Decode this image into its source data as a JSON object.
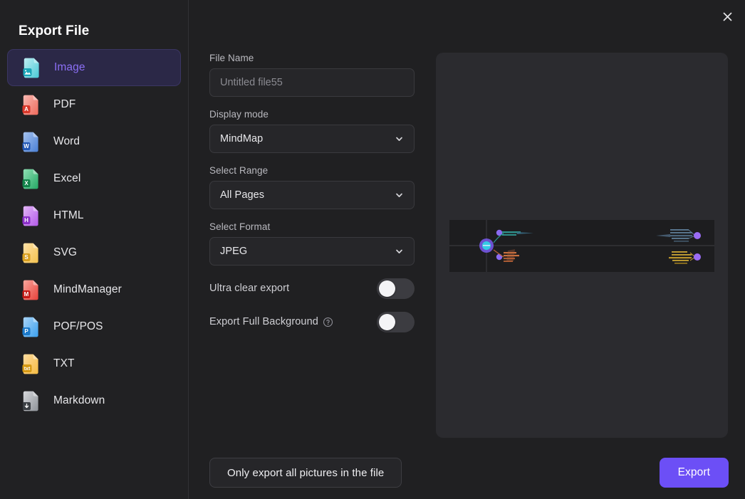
{
  "dialog": {
    "title": "Export File",
    "close_label": "×"
  },
  "sidebar": {
    "items": [
      {
        "label": "Image",
        "icon": "image-file-icon",
        "selected": true
      },
      {
        "label": "PDF",
        "icon": "pdf-file-icon",
        "selected": false
      },
      {
        "label": "Word",
        "icon": "word-file-icon",
        "selected": false
      },
      {
        "label": "Excel",
        "icon": "excel-file-icon",
        "selected": false
      },
      {
        "label": "HTML",
        "icon": "html-file-icon",
        "selected": false
      },
      {
        "label": "SVG",
        "icon": "svg-file-icon",
        "selected": false
      },
      {
        "label": "MindManager",
        "icon": "mindmanager-file-icon",
        "selected": false
      },
      {
        "label": "POF/POS",
        "icon": "pof-pos-file-icon",
        "selected": false
      },
      {
        "label": "TXT",
        "icon": "txt-file-icon",
        "selected": false
      },
      {
        "label": "Markdown",
        "icon": "markdown-file-icon",
        "selected": false
      }
    ]
  },
  "form": {
    "file_name": {
      "label": "File Name",
      "value": "",
      "placeholder": "Untitled file55"
    },
    "display_mode": {
      "label": "Display mode",
      "value": "MindMap"
    },
    "select_range": {
      "label": "Select Range",
      "value": "All Pages"
    },
    "select_format": {
      "label": "Select Format",
      "value": "JPEG"
    },
    "ultra_clear": {
      "label": "Ultra clear export",
      "state": "off"
    },
    "full_background": {
      "label": "Export Full Background",
      "state": "off",
      "help": "?"
    }
  },
  "footer": {
    "only_pictures_label": "Only export all pictures in the file",
    "export_label": "Export"
  },
  "colors": {
    "accent": "#6c4ff6",
    "selected_text": "#8b6ff5",
    "selected_bg": "#2b2847",
    "page_bg": "#202022",
    "panel_bg": "#2b2b2f",
    "canvas_bg": "#1d1d1f"
  }
}
